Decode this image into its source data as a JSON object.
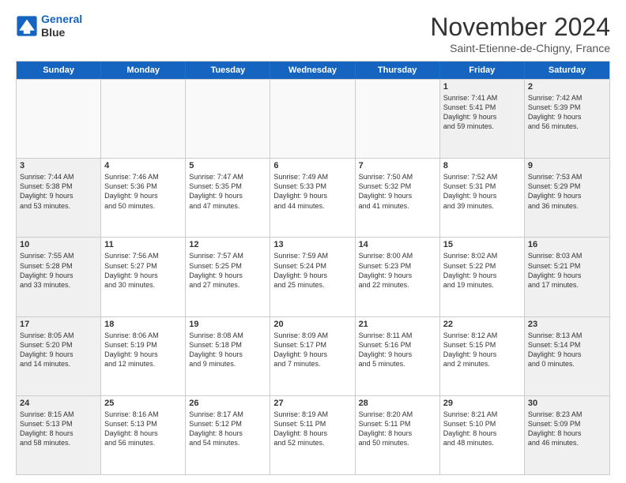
{
  "header": {
    "logo_line1": "General",
    "logo_line2": "Blue",
    "month": "November 2024",
    "location": "Saint-Etienne-de-Chigny, France"
  },
  "days_of_week": [
    "Sunday",
    "Monday",
    "Tuesday",
    "Wednesday",
    "Thursday",
    "Friday",
    "Saturday"
  ],
  "weeks": [
    [
      {
        "day": "",
        "info": []
      },
      {
        "day": "",
        "info": []
      },
      {
        "day": "",
        "info": []
      },
      {
        "day": "",
        "info": []
      },
      {
        "day": "",
        "info": []
      },
      {
        "day": "1",
        "info": [
          "Sunrise: 7:41 AM",
          "Sunset: 5:41 PM",
          "Daylight: 9 hours",
          "and 59 minutes."
        ]
      },
      {
        "day": "2",
        "info": [
          "Sunrise: 7:42 AM",
          "Sunset: 5:39 PM",
          "Daylight: 9 hours",
          "and 56 minutes."
        ]
      }
    ],
    [
      {
        "day": "3",
        "info": [
          "Sunrise: 7:44 AM",
          "Sunset: 5:38 PM",
          "Daylight: 9 hours",
          "and 53 minutes."
        ]
      },
      {
        "day": "4",
        "info": [
          "Sunrise: 7:46 AM",
          "Sunset: 5:36 PM",
          "Daylight: 9 hours",
          "and 50 minutes."
        ]
      },
      {
        "day": "5",
        "info": [
          "Sunrise: 7:47 AM",
          "Sunset: 5:35 PM",
          "Daylight: 9 hours",
          "and 47 minutes."
        ]
      },
      {
        "day": "6",
        "info": [
          "Sunrise: 7:49 AM",
          "Sunset: 5:33 PM",
          "Daylight: 9 hours",
          "and 44 minutes."
        ]
      },
      {
        "day": "7",
        "info": [
          "Sunrise: 7:50 AM",
          "Sunset: 5:32 PM",
          "Daylight: 9 hours",
          "and 41 minutes."
        ]
      },
      {
        "day": "8",
        "info": [
          "Sunrise: 7:52 AM",
          "Sunset: 5:31 PM",
          "Daylight: 9 hours",
          "and 39 minutes."
        ]
      },
      {
        "day": "9",
        "info": [
          "Sunrise: 7:53 AM",
          "Sunset: 5:29 PM",
          "Daylight: 9 hours",
          "and 36 minutes."
        ]
      }
    ],
    [
      {
        "day": "10",
        "info": [
          "Sunrise: 7:55 AM",
          "Sunset: 5:28 PM",
          "Daylight: 9 hours",
          "and 33 minutes."
        ]
      },
      {
        "day": "11",
        "info": [
          "Sunrise: 7:56 AM",
          "Sunset: 5:27 PM",
          "Daylight: 9 hours",
          "and 30 minutes."
        ]
      },
      {
        "day": "12",
        "info": [
          "Sunrise: 7:57 AM",
          "Sunset: 5:25 PM",
          "Daylight: 9 hours",
          "and 27 minutes."
        ]
      },
      {
        "day": "13",
        "info": [
          "Sunrise: 7:59 AM",
          "Sunset: 5:24 PM",
          "Daylight: 9 hours",
          "and 25 minutes."
        ]
      },
      {
        "day": "14",
        "info": [
          "Sunrise: 8:00 AM",
          "Sunset: 5:23 PM",
          "Daylight: 9 hours",
          "and 22 minutes."
        ]
      },
      {
        "day": "15",
        "info": [
          "Sunrise: 8:02 AM",
          "Sunset: 5:22 PM",
          "Daylight: 9 hours",
          "and 19 minutes."
        ]
      },
      {
        "day": "16",
        "info": [
          "Sunrise: 8:03 AM",
          "Sunset: 5:21 PM",
          "Daylight: 9 hours",
          "and 17 minutes."
        ]
      }
    ],
    [
      {
        "day": "17",
        "info": [
          "Sunrise: 8:05 AM",
          "Sunset: 5:20 PM",
          "Daylight: 9 hours",
          "and 14 minutes."
        ]
      },
      {
        "day": "18",
        "info": [
          "Sunrise: 8:06 AM",
          "Sunset: 5:19 PM",
          "Daylight: 9 hours",
          "and 12 minutes."
        ]
      },
      {
        "day": "19",
        "info": [
          "Sunrise: 8:08 AM",
          "Sunset: 5:18 PM",
          "Daylight: 9 hours",
          "and 9 minutes."
        ]
      },
      {
        "day": "20",
        "info": [
          "Sunrise: 8:09 AM",
          "Sunset: 5:17 PM",
          "Daylight: 9 hours",
          "and 7 minutes."
        ]
      },
      {
        "day": "21",
        "info": [
          "Sunrise: 8:11 AM",
          "Sunset: 5:16 PM",
          "Daylight: 9 hours",
          "and 5 minutes."
        ]
      },
      {
        "day": "22",
        "info": [
          "Sunrise: 8:12 AM",
          "Sunset: 5:15 PM",
          "Daylight: 9 hours",
          "and 2 minutes."
        ]
      },
      {
        "day": "23",
        "info": [
          "Sunrise: 8:13 AM",
          "Sunset: 5:14 PM",
          "Daylight: 9 hours",
          "and 0 minutes."
        ]
      }
    ],
    [
      {
        "day": "24",
        "info": [
          "Sunrise: 8:15 AM",
          "Sunset: 5:13 PM",
          "Daylight: 8 hours",
          "and 58 minutes."
        ]
      },
      {
        "day": "25",
        "info": [
          "Sunrise: 8:16 AM",
          "Sunset: 5:13 PM",
          "Daylight: 8 hours",
          "and 56 minutes."
        ]
      },
      {
        "day": "26",
        "info": [
          "Sunrise: 8:17 AM",
          "Sunset: 5:12 PM",
          "Daylight: 8 hours",
          "and 54 minutes."
        ]
      },
      {
        "day": "27",
        "info": [
          "Sunrise: 8:19 AM",
          "Sunset: 5:11 PM",
          "Daylight: 8 hours",
          "and 52 minutes."
        ]
      },
      {
        "day": "28",
        "info": [
          "Sunrise: 8:20 AM",
          "Sunset: 5:11 PM",
          "Daylight: 8 hours",
          "and 50 minutes."
        ]
      },
      {
        "day": "29",
        "info": [
          "Sunrise: 8:21 AM",
          "Sunset: 5:10 PM",
          "Daylight: 8 hours",
          "and 48 minutes."
        ]
      },
      {
        "day": "30",
        "info": [
          "Sunrise: 8:23 AM",
          "Sunset: 5:09 PM",
          "Daylight: 8 hours",
          "and 46 minutes."
        ]
      }
    ]
  ]
}
